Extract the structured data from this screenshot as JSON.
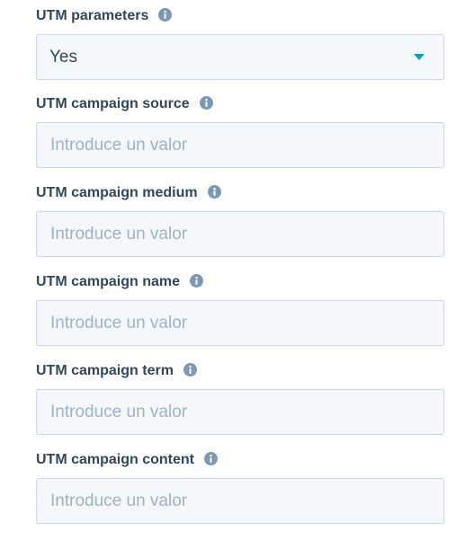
{
  "utm_parameters": {
    "label": "UTM parameters",
    "icon": "info-icon",
    "value": "Yes"
  },
  "fields": [
    {
      "label": "UTM campaign source",
      "placeholder": "Introduce un valor",
      "value": ""
    },
    {
      "label": "UTM campaign medium",
      "placeholder": "Introduce un valor",
      "value": ""
    },
    {
      "label": "UTM campaign name",
      "placeholder": "Introduce un valor",
      "value": ""
    },
    {
      "label": "UTM campaign term",
      "placeholder": "Introduce un valor",
      "value": ""
    },
    {
      "label": "UTM campaign content",
      "placeholder": "Introduce un valor",
      "value": ""
    }
  ],
  "colors": {
    "label": "#33475b",
    "info_icon": "#7c98b6",
    "field_bg": "#f5f8fa",
    "field_border": "#cbd6e2",
    "placeholder": "#9fb2c3",
    "accent": "#00a4bd"
  }
}
